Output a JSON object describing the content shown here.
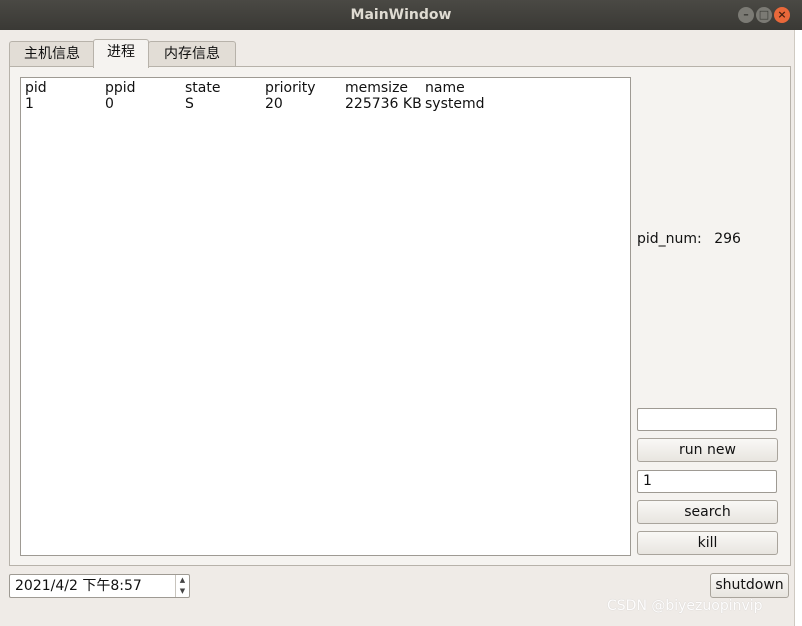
{
  "window": {
    "title": "MainWindow"
  },
  "tabs": [
    {
      "label": "主机信息"
    },
    {
      "label": "进程",
      "active": true
    },
    {
      "label": "内存信息"
    }
  ],
  "process_table": {
    "columns": [
      "pid",
      "ppid",
      "state",
      "priority",
      "memsize",
      "name"
    ],
    "rows": [
      [
        "1",
        "0",
        "S",
        "20",
        "225736 KB",
        "systemd"
      ]
    ]
  },
  "stats": {
    "pid_num_label": "pid_num:",
    "pid_num_value": "296"
  },
  "controls": {
    "run_input_value": "",
    "run_new_label": "run new",
    "pid_input_value": "1",
    "search_label": "search",
    "kill_label": "kill"
  },
  "footer": {
    "datetime": "2021/4/2 下午8:57",
    "shutdown_label": "shutdown"
  },
  "watermark": "CSDN @biyezuopinvip"
}
